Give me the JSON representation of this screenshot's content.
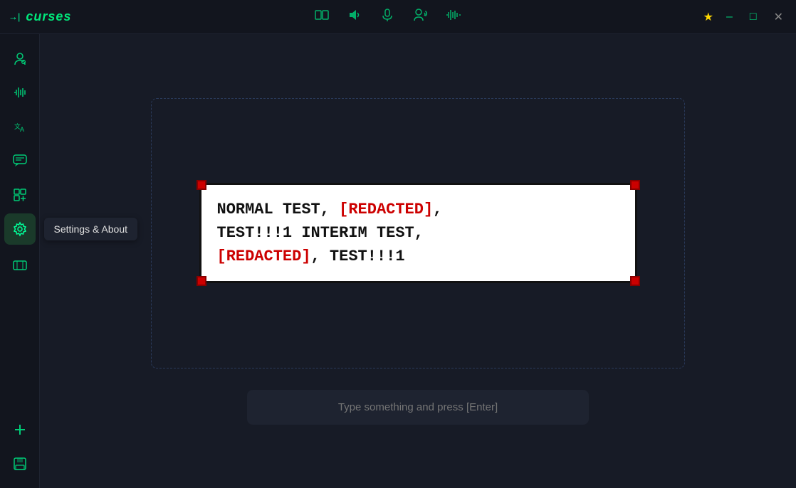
{
  "app": {
    "title": "curses",
    "logo_arrow": "→|"
  },
  "titlebar": {
    "icons": [
      {
        "name": "split-icon",
        "symbol": "⊡",
        "label": "Split"
      },
      {
        "name": "volume-icon",
        "symbol": "🔊",
        "label": "Volume"
      },
      {
        "name": "microphone-icon",
        "symbol": "🎤",
        "label": "Microphone"
      },
      {
        "name": "user-voice-icon",
        "symbol": "👤",
        "label": "User Voice"
      },
      {
        "name": "waveform-icon",
        "symbol": "▐▌",
        "label": "Waveform"
      }
    ],
    "pin_label": "★",
    "minimize_label": "–",
    "maximize_label": "□",
    "close_label": "✕"
  },
  "sidebar": {
    "items": [
      {
        "name": "avatar-icon",
        "symbol": "👤",
        "label": "Voice / Avatar"
      },
      {
        "name": "audio-icon",
        "symbol": "▐▌",
        "label": "Audio"
      },
      {
        "name": "translate-icon",
        "symbol": "文A",
        "label": "Translate"
      },
      {
        "name": "chat-icon",
        "symbol": "💬",
        "label": "Chat"
      },
      {
        "name": "plugins-icon",
        "symbol": "🧩",
        "label": "Plugins"
      },
      {
        "name": "settings-icon",
        "symbol": "⚙",
        "label": "Settings & About",
        "active": true
      },
      {
        "name": "display-icon",
        "symbol": "▣",
        "label": "Display"
      },
      {
        "name": "add-icon",
        "symbol": "+",
        "label": "Add"
      },
      {
        "name": "save-icon",
        "symbol": "💾",
        "label": "Save"
      }
    ],
    "tooltip": "Settings & About"
  },
  "preview": {
    "caption_parts": [
      {
        "text": "NORMAL TEST, ",
        "type": "normal"
      },
      {
        "text": "[REDACTED]",
        "type": "redacted"
      },
      {
        "text": ", TEST!!!1 INTERIM TEST, ",
        "type": "normal"
      },
      {
        "text": "[REDACTED]",
        "type": "redacted"
      },
      {
        "text": ", TEST!!!1",
        "type": "normal"
      }
    ]
  },
  "input": {
    "placeholder": "Type something and press [Enter]"
  }
}
